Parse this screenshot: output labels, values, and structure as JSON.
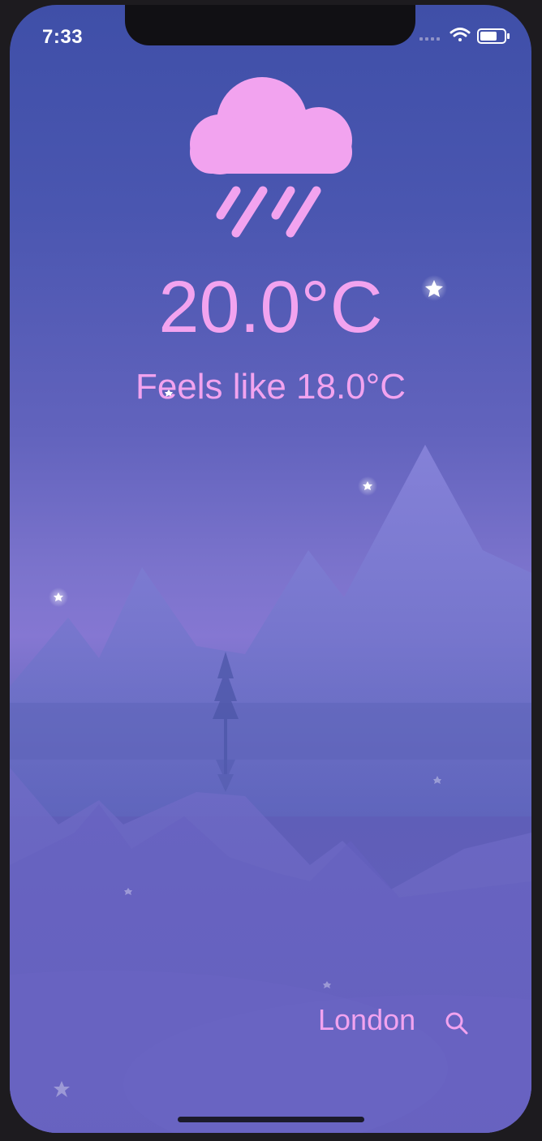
{
  "status_bar": {
    "time": "7:33",
    "icons": [
      "signal-icon",
      "wifi-icon",
      "battery-icon"
    ]
  },
  "weather": {
    "condition_icon": "rain-cloud-icon",
    "temperature": "20.0°C",
    "feels_like": "Feels like 18.0°C"
  },
  "location": {
    "city": "London",
    "search_icon": "search-icon"
  },
  "colors": {
    "accent": "#f2a3ef",
    "background_top": "#3f4fa8",
    "background_bottom": "#6662bd"
  }
}
